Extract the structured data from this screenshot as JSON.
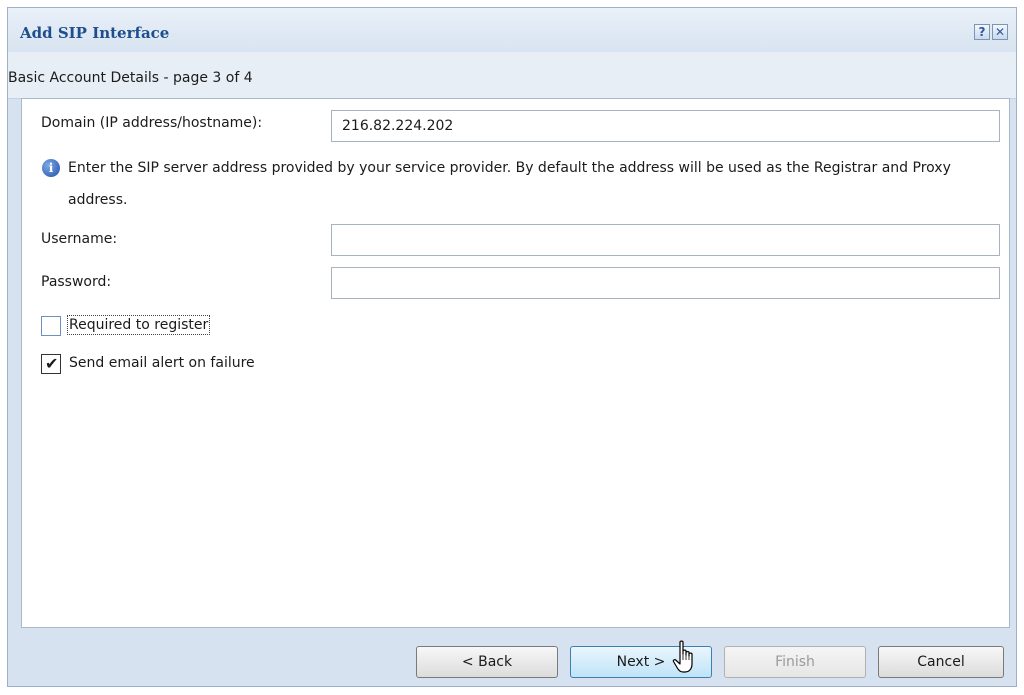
{
  "dialog": {
    "title": "Add SIP Interface",
    "help_icon": "help-icon",
    "close_icon": "close-icon",
    "help_glyph": "?",
    "close_glyph": "✕",
    "subtitle": "Basic Account Details - page 3 of 4"
  },
  "form": {
    "domain_label": "Domain (IP address/hostname):",
    "domain_value": "216.82.224.202",
    "info_icon": "info-icon",
    "info_glyph": "i",
    "info_text": "Enter the SIP server address provided by your service provider. By default the address will be used as the Registrar and Proxy address.",
    "username_label": "Username:",
    "username_value": "",
    "password_label": "Password:",
    "password_value": "",
    "required_to_register_label": "Required to register",
    "required_to_register_checked": false,
    "send_email_alert_label": "Send email alert on failure",
    "send_email_alert_checked": true,
    "check_glyph": "✔"
  },
  "buttons": {
    "back": "< Back",
    "next": "Next >",
    "finish": "Finish",
    "cancel": "Cancel"
  },
  "colors": {
    "title_text": "#1f4e8c",
    "dialog_bg": "#d6e2ef",
    "button_hover": "#bfe3f8"
  },
  "cursor_icon": "hand-pointer-icon"
}
